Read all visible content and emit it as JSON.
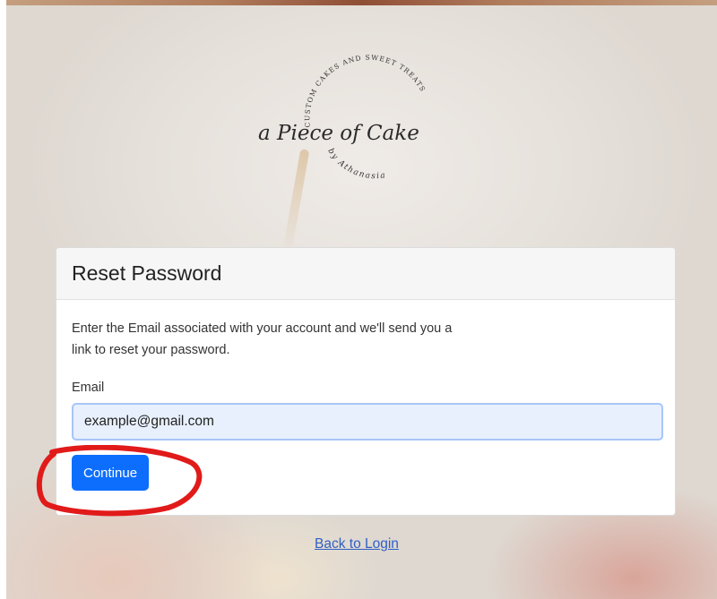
{
  "logo": {
    "arc_text": "CUSTOM CAKES AND SWEET TREATS",
    "brand_name": "a Piece of Cake",
    "byline": "by Athanasia"
  },
  "reset_form": {
    "title": "Reset Password",
    "description": "Enter the Email associated with your account and we'll send you a link to reset your password.",
    "email_label": "Email",
    "email_value": "example@gmail.com",
    "continue_label": "Continue"
  },
  "back_link": "Back to Login",
  "colors": {
    "primary_button": "#0d6efd",
    "input_autofill_bg": "#e8f0fe",
    "annotation_red": "#e11a1a",
    "link": "#2f5fc4"
  }
}
